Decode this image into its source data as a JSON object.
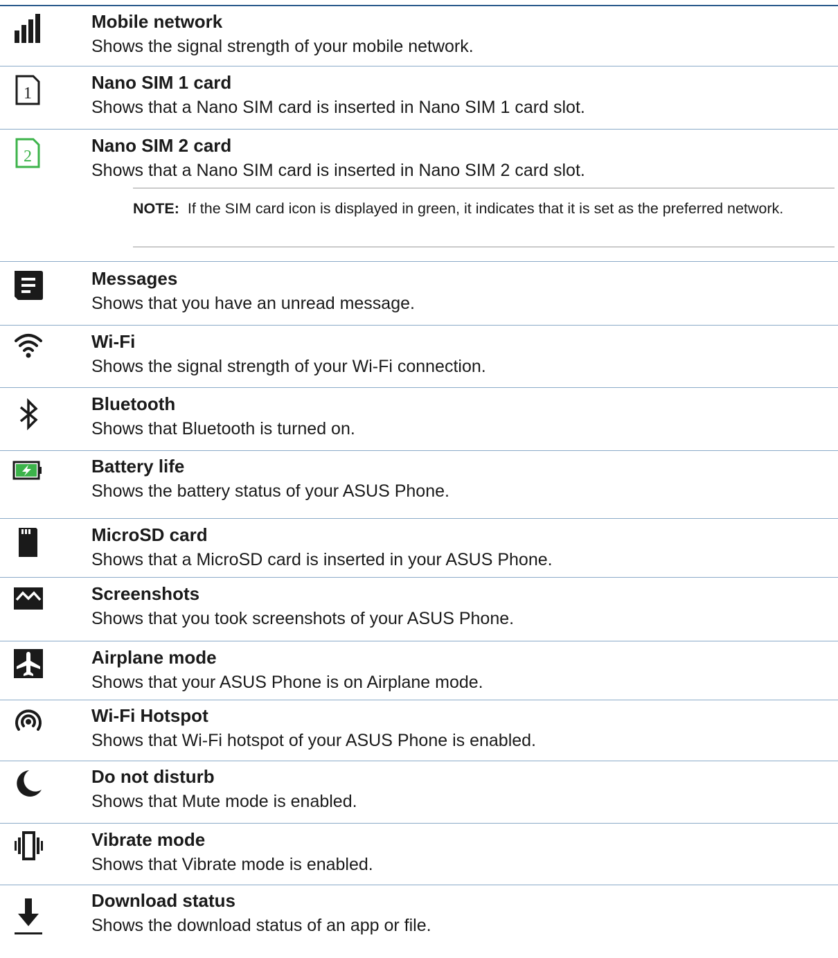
{
  "items": [
    {
      "icon": "signal-bars-icon",
      "title": "Mobile network",
      "description": "Shows the signal strength of your mobile network."
    },
    {
      "icon": "sim-1-icon",
      "title": "Nano SIM 1 card",
      "description": "Shows that a Nano SIM card is inserted in Nano SIM 1 card slot."
    },
    {
      "icon": "sim-2-icon",
      "title": "Nano SIM 2 card",
      "description": "Shows that a Nano SIM card is inserted in Nano SIM 2 card slot."
    },
    {
      "icon": "messages-icon",
      "title": "Messages",
      "description": "Shows that you have an unread message."
    },
    {
      "icon": "wifi-icon",
      "title": "Wi-Fi",
      "description": "Shows the signal strength of your Wi-Fi connection."
    },
    {
      "icon": "bluetooth-icon",
      "title": "Bluetooth",
      "description": "Shows that Bluetooth is turned on."
    },
    {
      "icon": "battery-charging-icon",
      "title": "Battery life",
      "description": "Shows the battery status of your ASUS Phone."
    },
    {
      "icon": "microsd-icon",
      "title": "MicroSD card",
      "description": "Shows that a MicroSD card is inserted in your ASUS Phone."
    },
    {
      "icon": "screenshot-icon",
      "title": "Screenshots",
      "description": "Shows that you took screenshots of your ASUS Phone."
    },
    {
      "icon": "airplane-icon",
      "title": "Airplane mode",
      "description": "Shows that your ASUS Phone is on Airplane mode."
    },
    {
      "icon": "hotspot-icon",
      "title": "Wi-Fi Hotspot",
      "description": "Shows that Wi-Fi hotspot of your ASUS Phone is enabled."
    },
    {
      "icon": "moon-icon",
      "title": "Do not disturb",
      "description": "Shows that Mute mode is enabled."
    },
    {
      "icon": "vibrate-icon",
      "title": "Vibrate mode",
      "description": "Shows that Vibrate mode is enabled."
    },
    {
      "icon": "download-icon",
      "title": "Download status",
      "description": "Shows the download status of an app or file."
    }
  ],
  "note": {
    "label": "NOTE:",
    "text": "If the SIM card icon is displayed in green, it indicates that it is set as the preferred network."
  },
  "colors": {
    "rule": "#8aaac8",
    "top_rule": "#2a5a8c",
    "sim_green": "#3cb34a",
    "icon_dark": "#1a1a1a"
  }
}
